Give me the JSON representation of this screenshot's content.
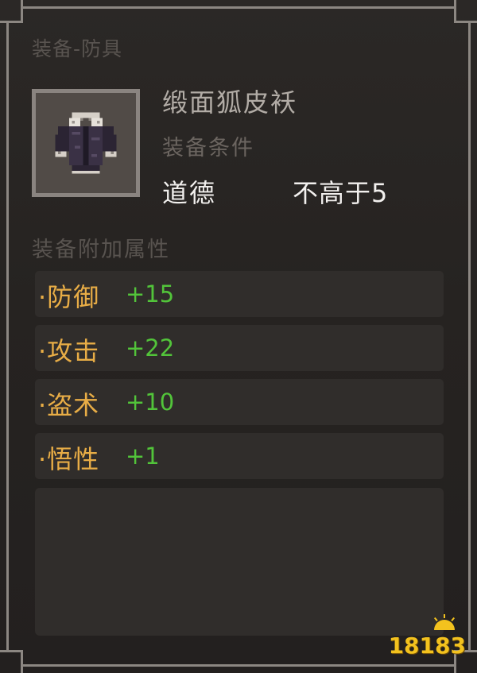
{
  "category": "装备-防具",
  "item": {
    "name": "缎面狐皮袄",
    "icon": "fur-coat-icon"
  },
  "requirement": {
    "title": "装备条件",
    "stat": "道德",
    "value": "不高于5"
  },
  "attributes": {
    "title": "装备附加属性",
    "items": [
      {
        "name": "·防御",
        "value": "+15"
      },
      {
        "name": "·攻击",
        "value": "+22"
      },
      {
        "name": "·盗术",
        "value": "+10"
      },
      {
        "name": "·悟性",
        "value": "+1"
      }
    ]
  },
  "watermark": "18183",
  "colors": {
    "attr_name": "#e8ad46",
    "attr_value": "#52c43a",
    "watermark": "#f3c21e"
  }
}
